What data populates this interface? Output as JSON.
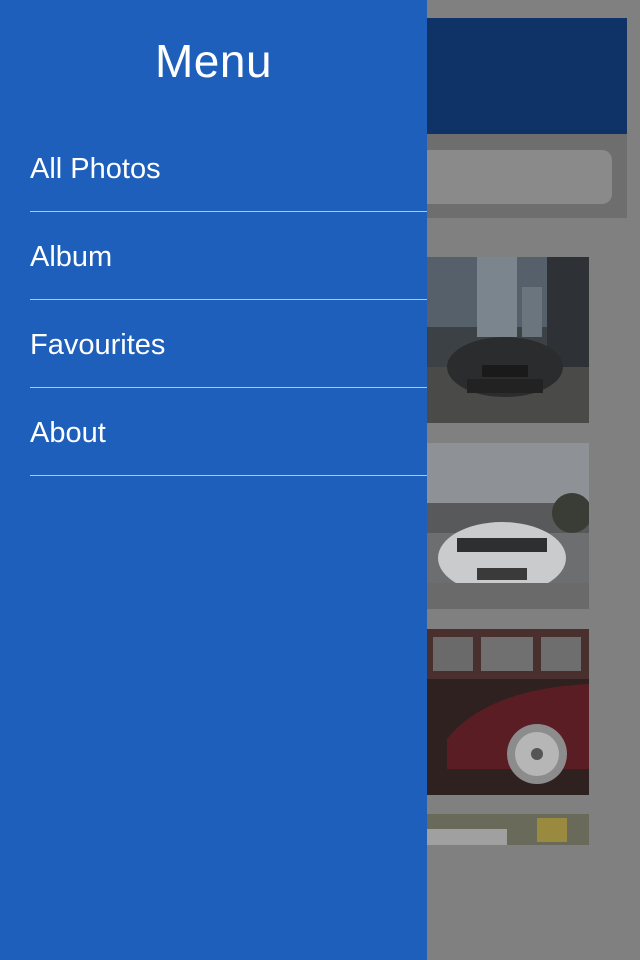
{
  "drawer": {
    "title": "Menu",
    "items": [
      {
        "label": "All Photos"
      },
      {
        "label": "Album"
      },
      {
        "label": "Favourites"
      },
      {
        "label": "About"
      }
    ]
  },
  "colors": {
    "drawer_background": "#1e5fbb",
    "overlay_dim": "#808080",
    "navbar_dimmed": "#0f3366"
  }
}
